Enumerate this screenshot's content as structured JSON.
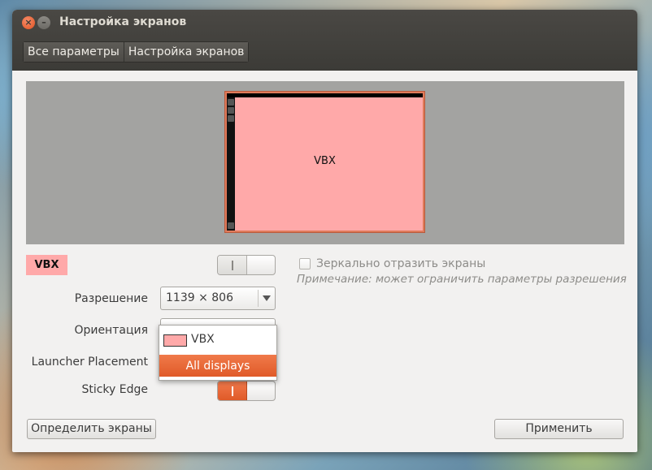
{
  "window": {
    "title": "Настройка экранов",
    "close_icon": "close-icon",
    "minimize_icon": "minimize-icon"
  },
  "breadcrumbs": [
    "Все параметры",
    "Настройка экранов"
  ],
  "preview": {
    "monitor_label": "VBX",
    "monitor_color": "#ffa9a9",
    "selection_color": "#e07a5a"
  },
  "display": {
    "name": "VBX",
    "power_on": false
  },
  "mirror": {
    "label": "Зеркально отразить экраны",
    "checked": false,
    "note": "Примечание: может ограничить параметры разрешения"
  },
  "settings": {
    "resolution_label": "Разрешение",
    "resolution_value": "1139 × 806",
    "orientation_label": "Ориентация",
    "launcher_label": "Launcher Placement",
    "sticky_label": "Sticky Edge",
    "sticky_on": true
  },
  "launcher_dropdown": {
    "options": [
      {
        "label": "VBX",
        "swatch": "#ffa9a9",
        "selected": false
      },
      {
        "label": "All displays",
        "selected": true
      }
    ],
    "highlight_color": "#e8652f"
  },
  "buttons": {
    "detect": "Определить экраны",
    "apply": "Применить"
  }
}
